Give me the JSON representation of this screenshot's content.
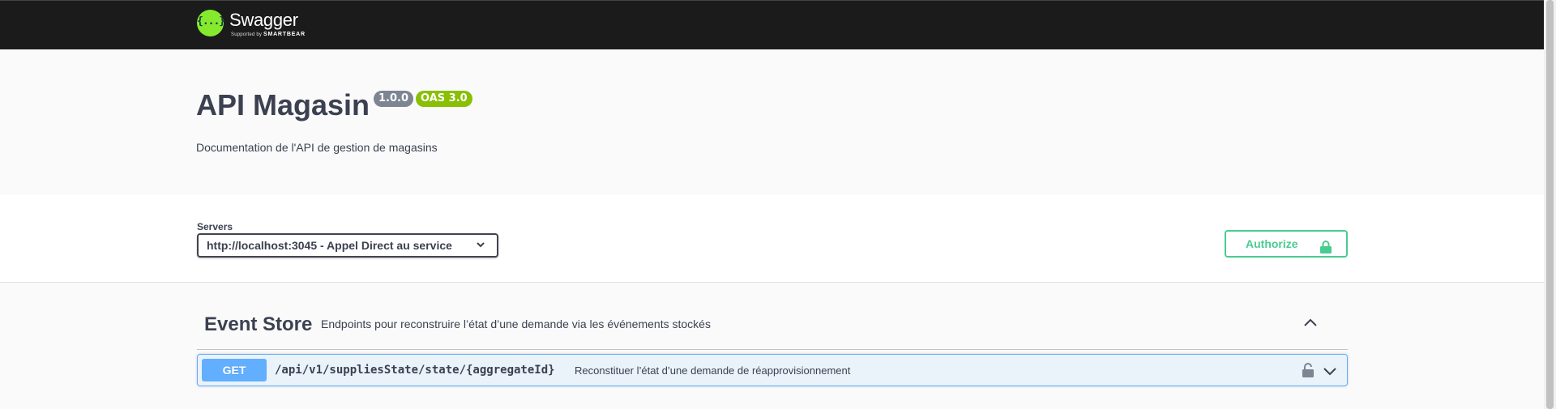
{
  "topbar": {
    "logo_title": "Swagger",
    "logo_supported": "Supported by",
    "logo_brand": "SMARTBEAR",
    "logo_icon": "swagger-logo-icon"
  },
  "info": {
    "title": "API Magasin",
    "version": "1.0.0",
    "oas": "OAS 3.0",
    "description": "Documentation de l'API de gestion de magasins"
  },
  "servers": {
    "label": "Servers",
    "selected": "http://localhost:3045 - Appel Direct au service",
    "authorize_label": "Authorize"
  },
  "tags": [
    {
      "name": "Event Store",
      "description": "Endpoints pour reconstruire l’état d’une demande via les événements stockés",
      "operations": [
        {
          "method": "GET",
          "path": "/api/v1/suppliesState/state/{aggregateId}",
          "summary": "Reconstituer l’état d’une demande de réapprovisionnement"
        }
      ]
    }
  ],
  "colors": {
    "topbar_bg": "#1b1b1b",
    "logo_green": "#85ea2d",
    "authorize_green": "#49cc90",
    "get_blue": "#61affe",
    "version_badge": "#7d8492",
    "oas_badge": "#89bf04"
  }
}
